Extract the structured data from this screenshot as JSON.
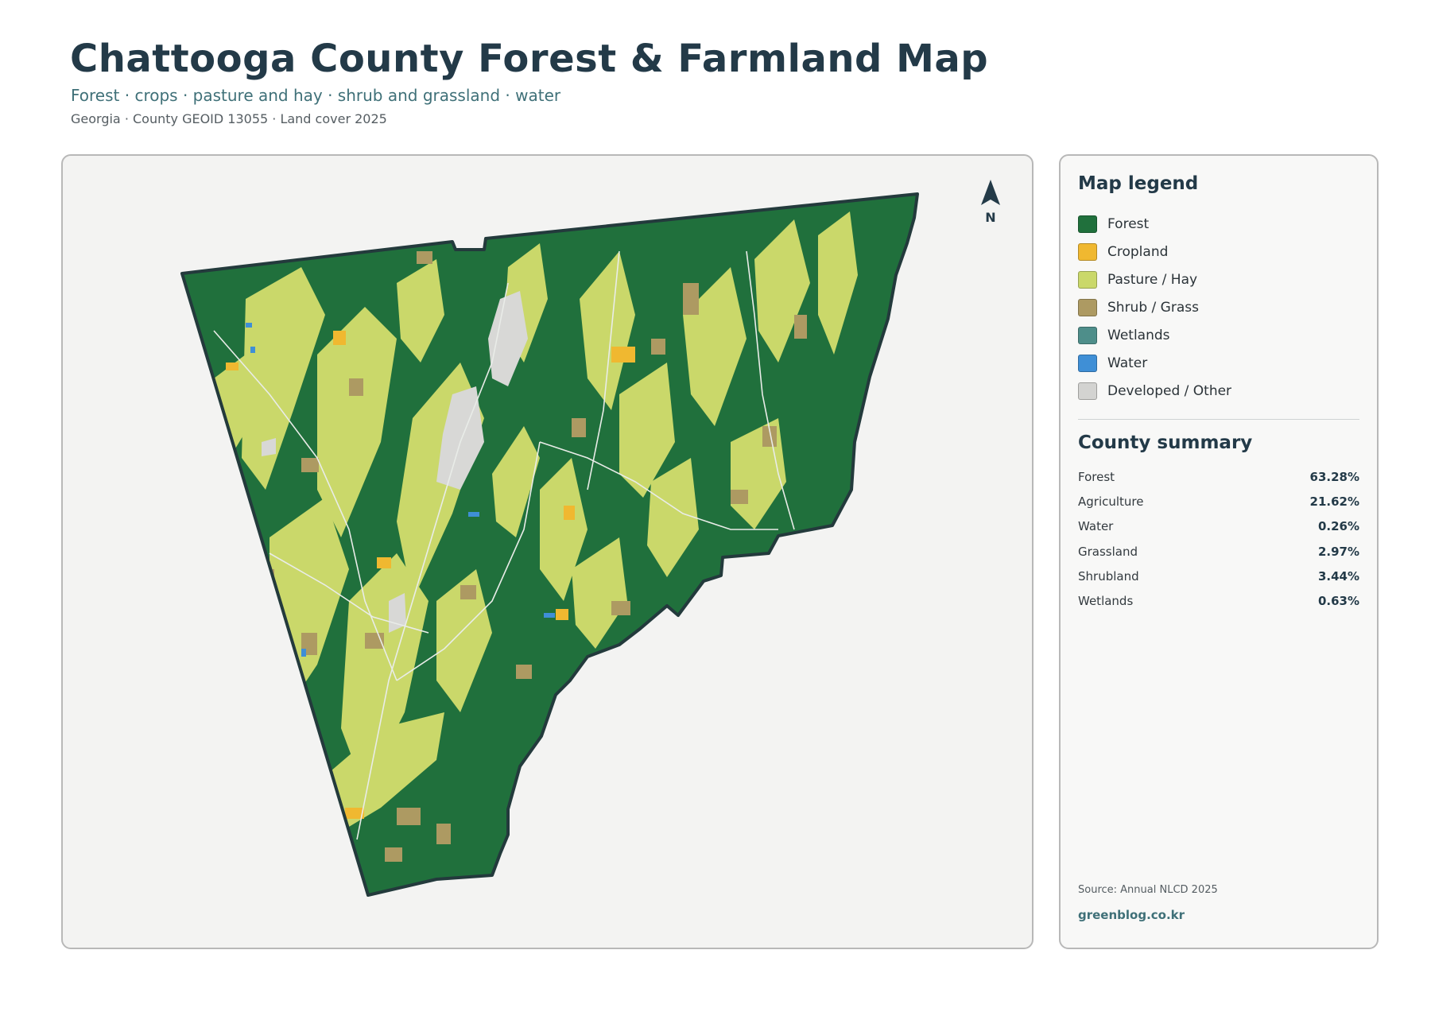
{
  "header": {
    "title": "Chattooga County Forest & Farmland Map",
    "subtitle": "Forest · crops · pasture and hay · shrub and grassland · water",
    "meta": "Georgia · County GEOID 13055 · Land cover 2025"
  },
  "map": {
    "north_label": "N",
    "colors": {
      "forest": "#20703c",
      "cropland": "#f0b830",
      "pasture": "#cad86a",
      "shrub": "#ad9a62",
      "wetlands": "#4e8e8a",
      "water": "#3f8fd6",
      "developed": "#d8d8d6",
      "outline": "#233a3c",
      "panel_bg": "#f3f3f2"
    }
  },
  "legend": {
    "title": "Map legend",
    "items": [
      {
        "label": "Forest",
        "color": "#20703c"
      },
      {
        "label": "Cropland",
        "color": "#f0b830"
      },
      {
        "label": "Pasture / Hay",
        "color": "#cad86a"
      },
      {
        "label": "Shrub / Grass",
        "color": "#ad9a62"
      },
      {
        "label": "Wetlands",
        "color": "#4e8e8a"
      },
      {
        "label": "Water",
        "color": "#3f8fd6"
      },
      {
        "label": "Developed / Other",
        "color": "#d3d3d1"
      }
    ]
  },
  "summary": {
    "title": "County summary",
    "rows": [
      {
        "label": "Forest",
        "value": "63.28%"
      },
      {
        "label": "Agriculture",
        "value": "21.62%"
      },
      {
        "label": "Water",
        "value": "0.26%"
      },
      {
        "label": "Grassland",
        "value": "2.97%"
      },
      {
        "label": "Shrubland",
        "value": "3.44%"
      },
      {
        "label": "Wetlands",
        "value": "0.63%"
      }
    ]
  },
  "footer": {
    "source": "Source: Annual NLCD 2025",
    "site": "greenblog.co.kr"
  }
}
